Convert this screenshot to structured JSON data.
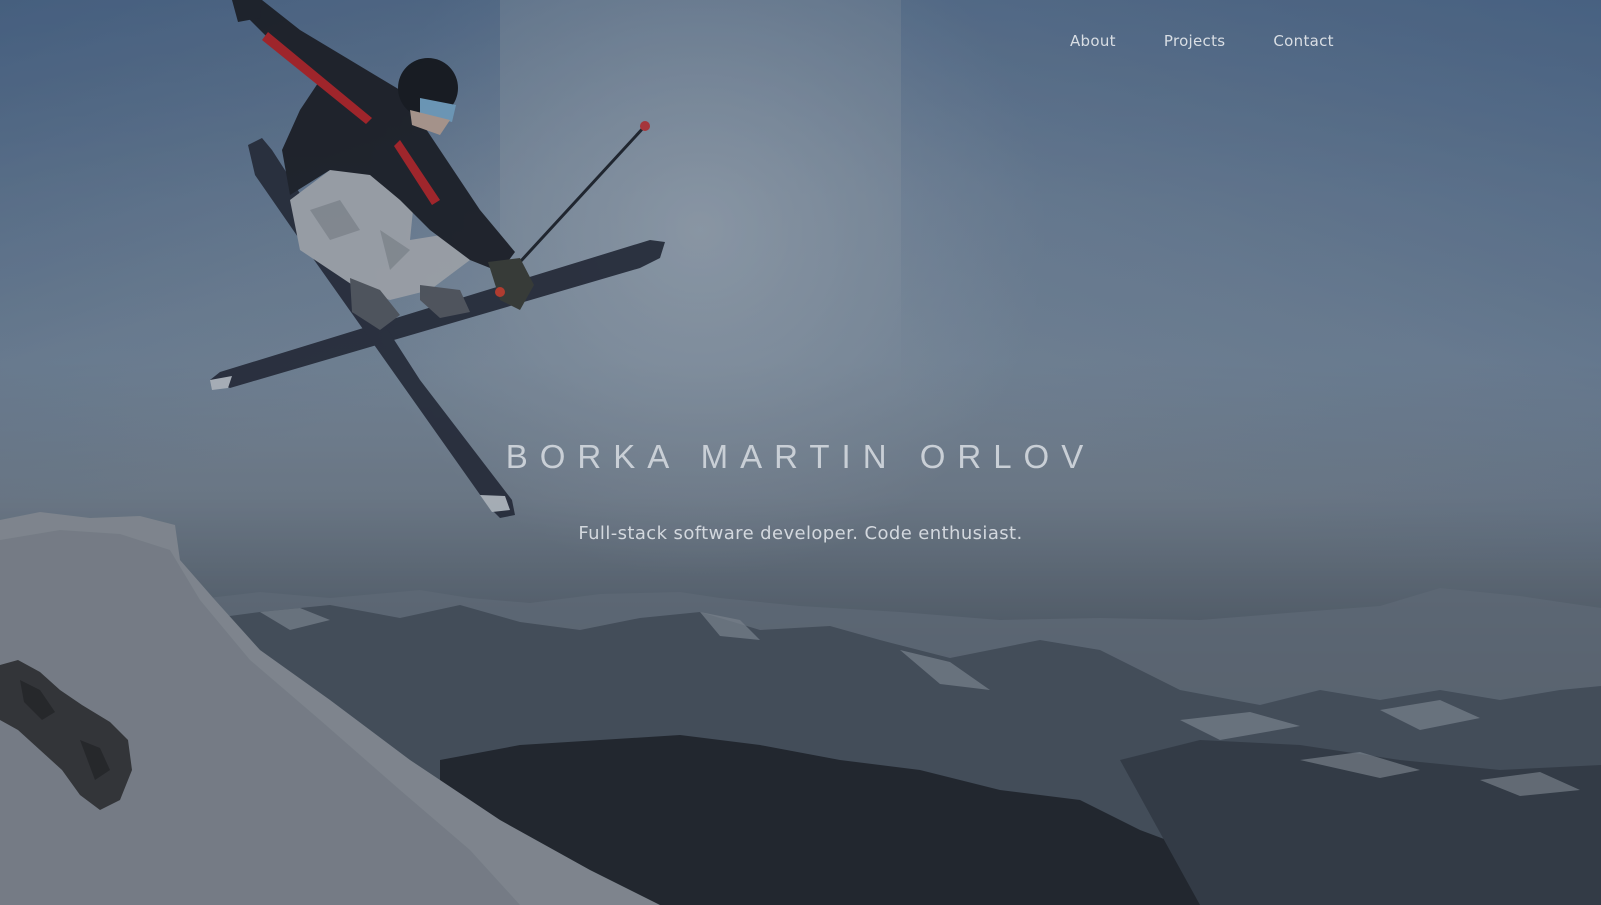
{
  "nav": {
    "items": [
      {
        "label": "About"
      },
      {
        "label": "Projects"
      },
      {
        "label": "Contact"
      }
    ]
  },
  "hero": {
    "title": "BORKA MARTIN ORLOV",
    "subtitle": "Full-stack software developer. Code enthusiast."
  },
  "colors": {
    "text_primary": "#c9cfd6",
    "nav_text": "#d9dee4",
    "sky": "#7f93a8",
    "ground_dark": "#2a3038"
  },
  "background": {
    "subject": "freestyle skier mid-air with crossed skis above snowy mountain range"
  }
}
